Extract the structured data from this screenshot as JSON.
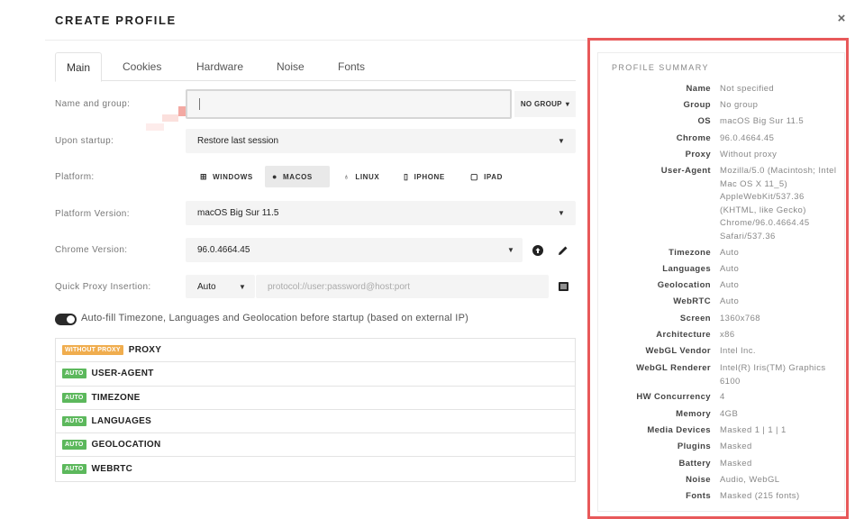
{
  "dialog": {
    "title": "CREATE PROFILE",
    "close_glyph": "×"
  },
  "tabs": [
    {
      "label": "Main"
    },
    {
      "label": "Cookies"
    },
    {
      "label": "Hardware"
    },
    {
      "label": "Noise"
    },
    {
      "label": "Fonts"
    }
  ],
  "form": {
    "name_group_label": "Name and group:",
    "name_value": "",
    "group_button": "NO GROUP",
    "startup_label": "Upon startup:",
    "startup_value": "Restore last session",
    "platform_label": "Platform:",
    "platforms": [
      {
        "label": "WINDOWS",
        "icon": "windows-icon",
        "glyph": "⊞"
      },
      {
        "label": "MACOS",
        "icon": "apple-icon",
        "glyph": "●"
      },
      {
        "label": "LINUX",
        "icon": "linux-icon",
        "glyph": "♁"
      },
      {
        "label": "IPHONE",
        "icon": "phone-icon",
        "glyph": "▯"
      },
      {
        "label": "IPAD",
        "icon": "tablet-icon",
        "glyph": "▢"
      }
    ],
    "selected_platform": "MACOS",
    "platform_version_label": "Platform Version:",
    "platform_version_value": "macOS Big Sur 11.5",
    "chrome_version_label": "Chrome Version:",
    "chrome_version_value": "96.0.4664.45",
    "proxy_label": "Quick Proxy Insertion:",
    "proxy_mode": "Auto",
    "proxy_placeholder": "protocol://user:password@host:port",
    "autofill_label": "Auto-fill Timezone, Languages and Geolocation before startup (based on external IP)",
    "autofill_enabled": true
  },
  "auto_list": [
    {
      "badge": "WITHOUT PROXY",
      "name": "PROXY",
      "badge_color": "#f0ad4e"
    },
    {
      "badge": "AUTO",
      "name": "USER-AGENT",
      "badge_color": "#5cb85c"
    },
    {
      "badge": "AUTO",
      "name": "TIMEZONE",
      "badge_color": "#5cb85c"
    },
    {
      "badge": "AUTO",
      "name": "LANGUAGES",
      "badge_color": "#5cb85c"
    },
    {
      "badge": "AUTO",
      "name": "GEOLOCATION",
      "badge_color": "#5cb85c"
    },
    {
      "badge": "AUTO",
      "name": "WEBRTC",
      "badge_color": "#5cb85c"
    }
  ],
  "summary": {
    "title": "PROFILE SUMMARY",
    "rows": [
      {
        "key": "Name",
        "value": "Not specified"
      },
      {
        "key": "Group",
        "value": "No group"
      },
      {
        "key": "OS",
        "value": "macOS Big Sur 11.5"
      },
      {
        "key": "Chrome",
        "value": "96.0.4664.45"
      },
      {
        "key": "Proxy",
        "value": "Without proxy"
      },
      {
        "key": "User-Agent",
        "value": "Mozilla/5.0 (Macintosh; Intel Mac OS X 11_5) AppleWebKit/537.36 (KHTML, like Gecko) Chrome/96.0.4664.45 Safari/537.36"
      },
      {
        "key": "Timezone",
        "value": "Auto"
      },
      {
        "key": "Languages",
        "value": "Auto"
      },
      {
        "key": "Geolocation",
        "value": "Auto"
      },
      {
        "key": "WebRTC",
        "value": "Auto"
      },
      {
        "key": "Screen",
        "value": "1360x768"
      },
      {
        "key": "Architecture",
        "value": "x86"
      },
      {
        "key": "WebGL Vendor",
        "value": "Intel Inc."
      },
      {
        "key": "WebGL Renderer",
        "value": "Intel(R) Iris(TM) Graphics 6100"
      },
      {
        "key": "HW Concurrency",
        "value": "4"
      },
      {
        "key": "Memory",
        "value": "4GB"
      },
      {
        "key": "Media Devices",
        "value": "Masked 1 | 1 | 1"
      },
      {
        "key": "Plugins",
        "value": "Masked"
      },
      {
        "key": "Battery",
        "value": "Masked"
      },
      {
        "key": "Noise",
        "value": "Audio, WebGL"
      },
      {
        "key": "Fonts",
        "value": "Masked (215 fonts)"
      }
    ]
  },
  "colors": {
    "accent_border": "#e8595a",
    "badge_auto": "#5cb85c",
    "badge_warn": "#f0ad4e"
  }
}
